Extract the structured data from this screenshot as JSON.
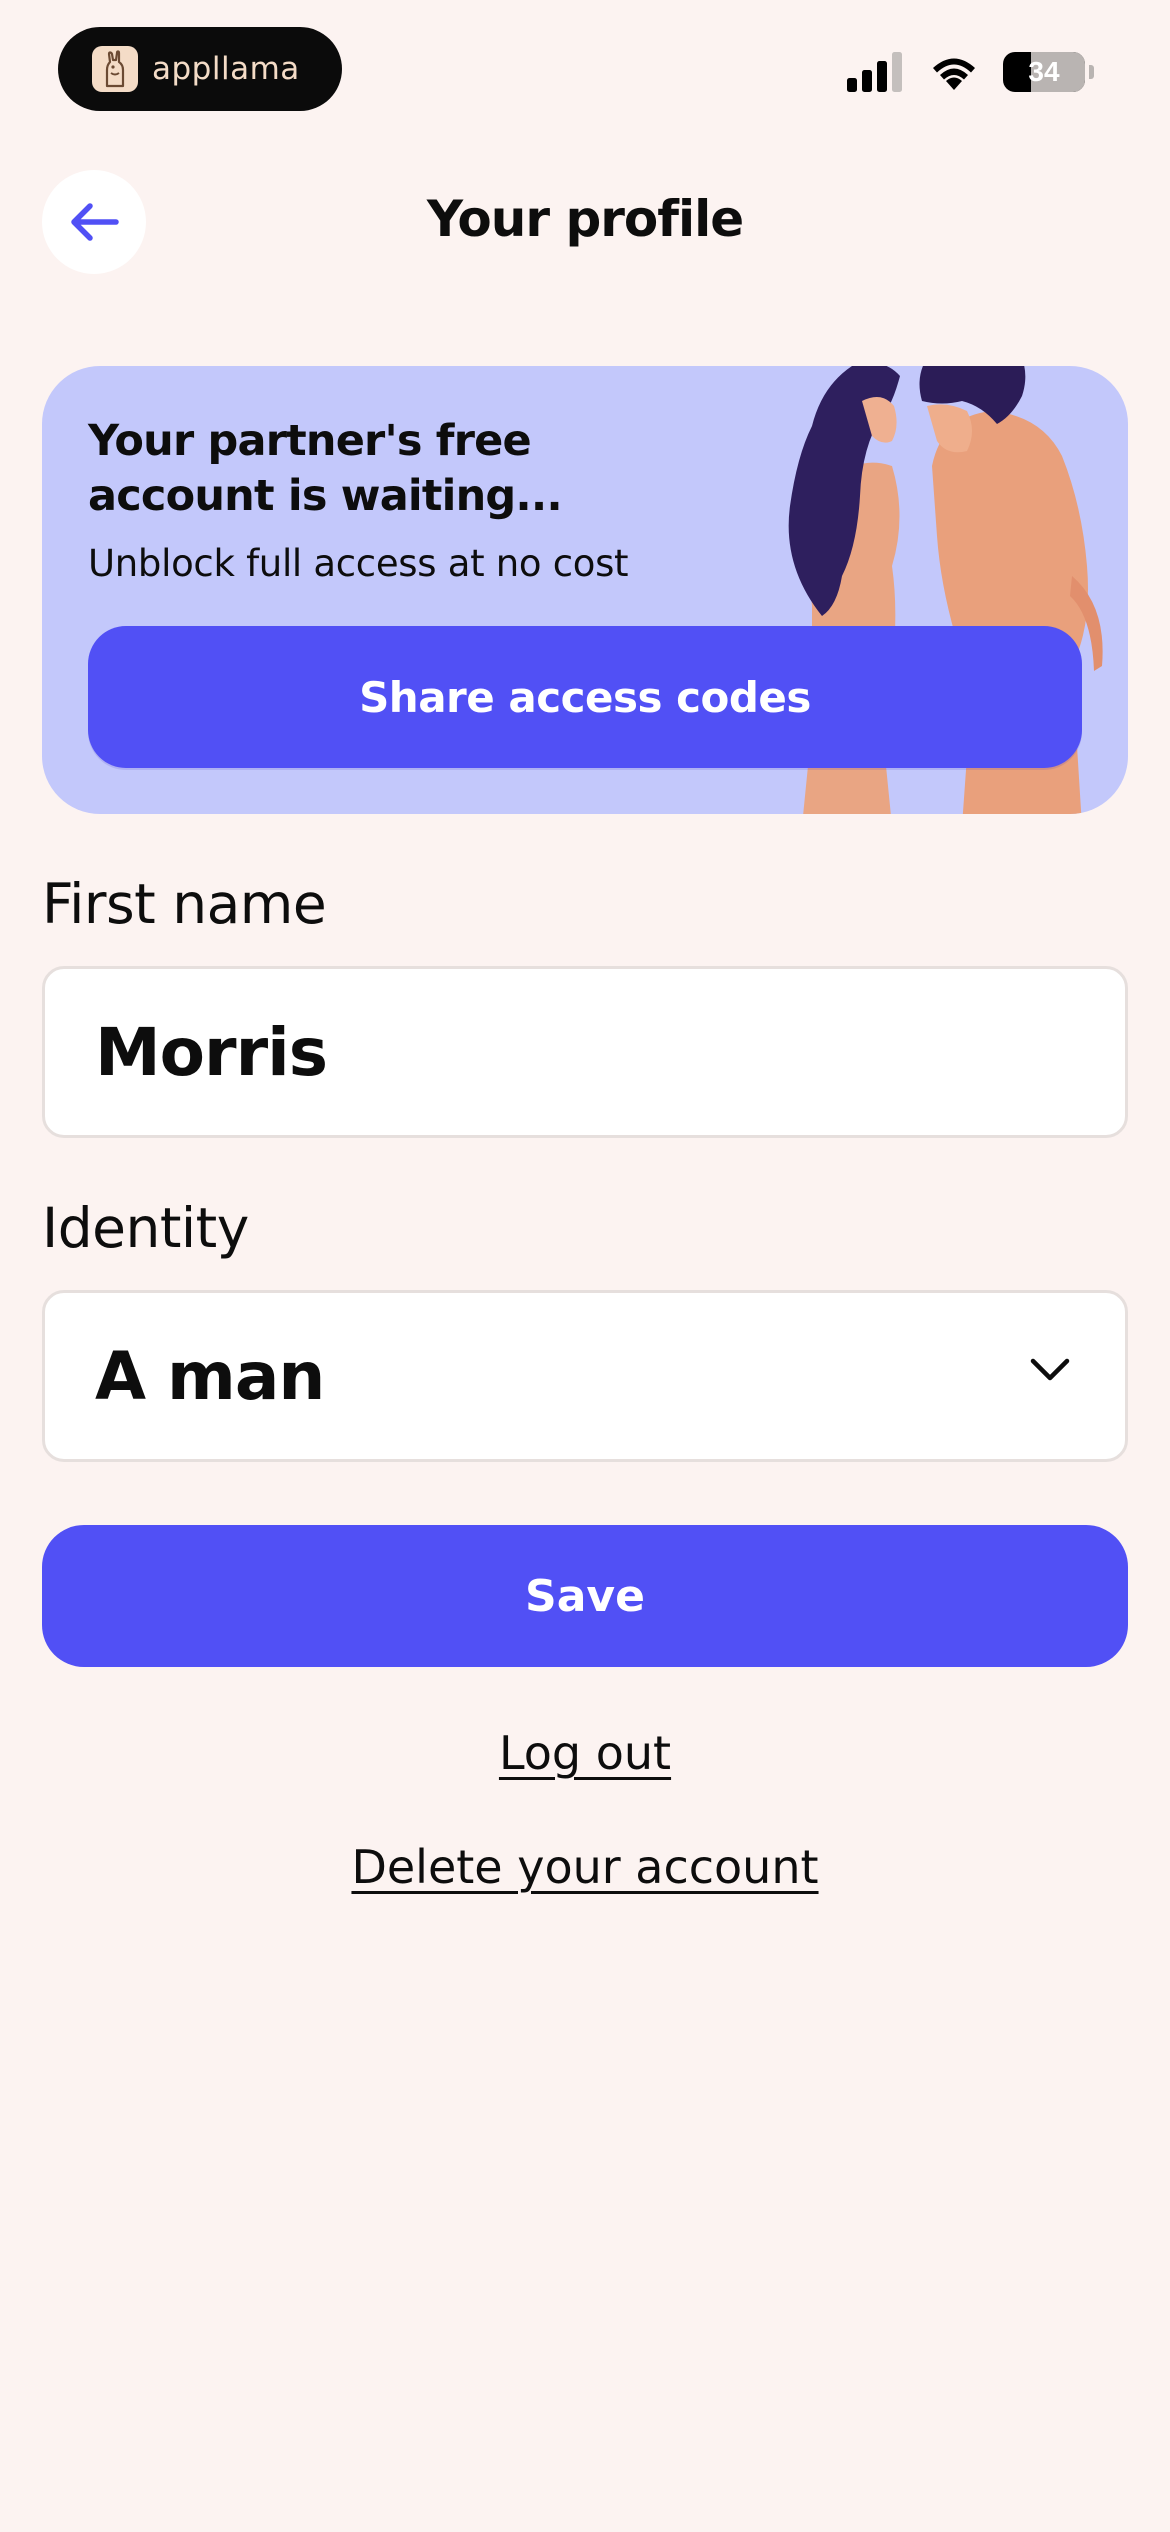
{
  "status_bar": {
    "app_badge_label": "appllama",
    "battery_level": "34",
    "battery_fraction": 0.34
  },
  "header": {
    "title": "Your profile"
  },
  "banner": {
    "title": "Your partner's free account is waiting...",
    "subtitle": "Unblock full access at no cost",
    "button_label": "Share access codes",
    "background_color": "#c3c8fb"
  },
  "form": {
    "first_name_label": "First name",
    "first_name_value": "Morris",
    "identity_label": "Identity",
    "identity_value": "A man"
  },
  "actions": {
    "save_label": "Save",
    "logout_label": "Log out",
    "delete_label": "Delete your account"
  },
  "colors": {
    "accent": "#5150f5",
    "page_background": "#fcf3f1"
  },
  "icons": [
    "llama-app-icon",
    "cellular-signal-icon",
    "wifi-icon",
    "battery-icon",
    "back-arrow-icon",
    "chevron-down-icon"
  ]
}
